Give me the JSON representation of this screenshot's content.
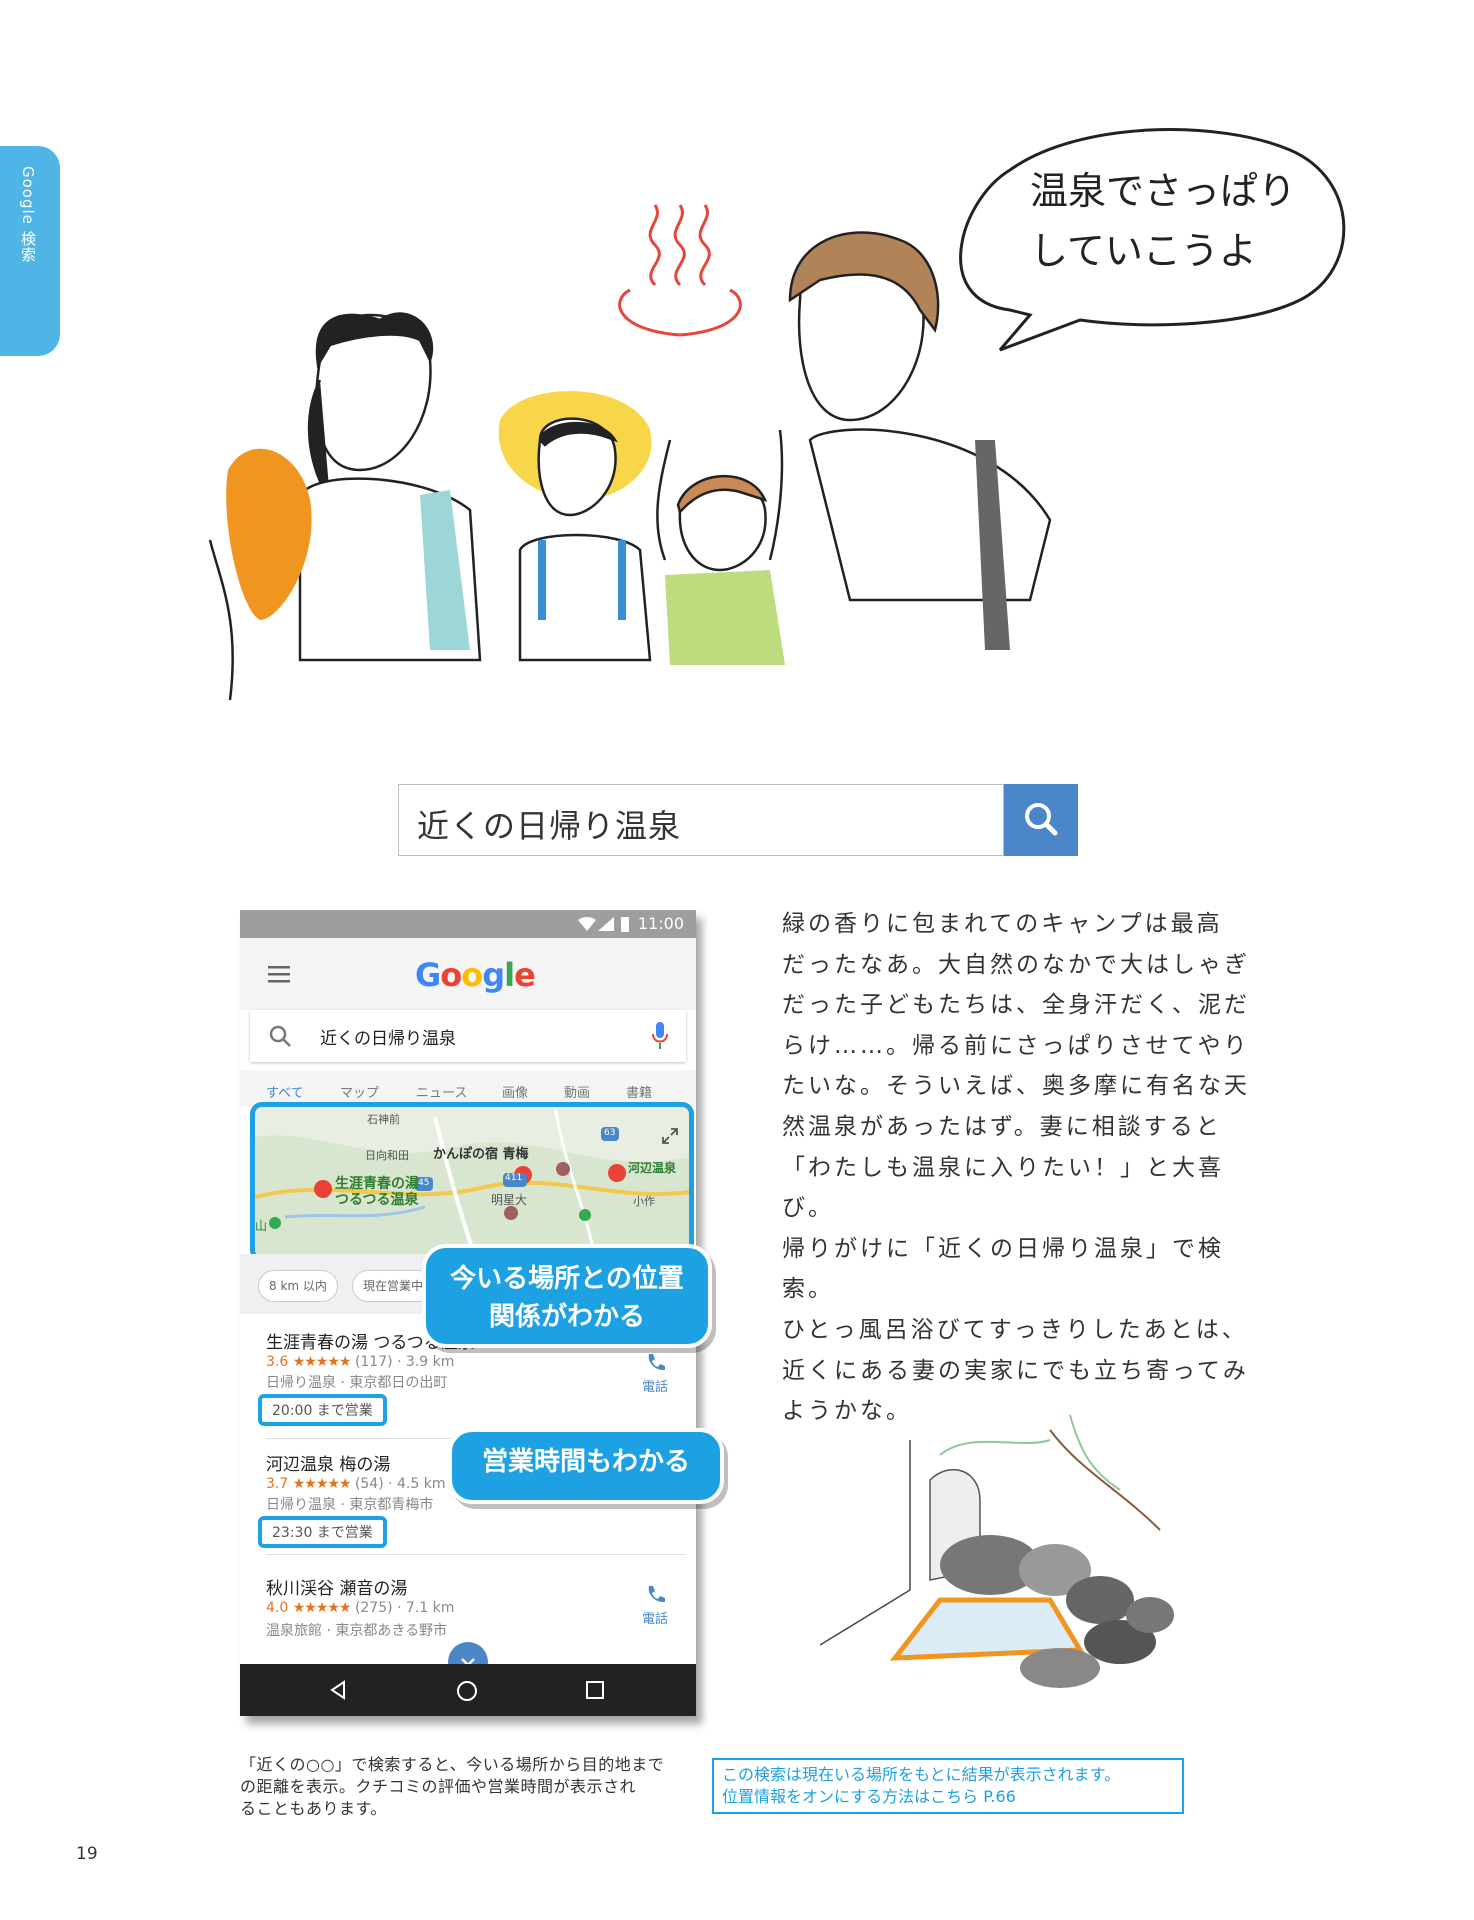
{
  "side_tab": {
    "label": "Google 検索"
  },
  "illustration": {
    "speech_line1": "温泉でさっぱり",
    "speech_line2": "していこうよ"
  },
  "search": {
    "query": "近くの日帰り温泉",
    "icon": "search-icon",
    "button_color": "#4a86c8"
  },
  "phone": {
    "status_time": "11:00",
    "logo": "Google",
    "search_query": "近くの日帰り温泉",
    "tabs": [
      "すべて",
      "マップ",
      "ニュース",
      "画像",
      "動画",
      "書籍"
    ],
    "map_labels": {
      "ishigamimae": "石神前",
      "hinatawada": "日向和田",
      "kanbonoyado": "かんぽの宿 青梅",
      "kawabe": "河辺温泉",
      "shogai_1": "生涯青春の湯",
      "shogai_2": "つるつる温泉",
      "meisei": "明星大",
      "ozaku": "小作",
      "yama": "山",
      "r411": "411",
      "r45": "45",
      "r63": "63"
    },
    "chips": [
      "8 km 以内",
      "現在営業中"
    ],
    "results": [
      {
        "name": "生涯青春の湯 つるつる温泉",
        "rating": "3.6",
        "stars": "★★★★★",
        "reviews": "(117) · 3.9 km",
        "info": "日帰り温泉 · 東京都日の出町",
        "hours": "20:00 まで営業",
        "call": "電話"
      },
      {
        "name": "河辺温泉 梅の湯",
        "rating": "3.7",
        "stars": "★★★★★",
        "reviews": "(54) · 4.5 km",
        "info": "日帰り温泉 · 東京都青梅市",
        "hours": "23:30 まで営業",
        "call": "電話"
      },
      {
        "name": "秋川渓谷 瀬音の湯",
        "rating": "4.0",
        "stars": "★★★★★",
        "reviews": "(275) · 7.1 km",
        "info": "温泉旅館 · 東京都あきる野市",
        "hours": "",
        "call": "電話"
      }
    ],
    "accent": "#1da1e2"
  },
  "callouts": {
    "location_line1": "今いる場所との位置",
    "location_line2": "関係がわかる",
    "hours": "営業時間もわかる"
  },
  "body_text": [
    "緑の香りに包まれてのキャンプは最高",
    "だったなあ。大自然のなかで大はしゃぎ",
    "だった子どもたちは、全身汗だく、泥だ",
    "らけ……。帰る前にさっぱりさせてやり",
    "たいな。そういえば、奥多摩に有名な天",
    "然温泉があったはず。妻に相談すると",
    "「わたしも温泉に入りたい！」と大喜び。",
    "帰りがけに「近くの日帰り温泉」で検索。",
    "ひとっ風呂浴びてすっきりしたあとは、",
    "近くにある妻の実家にでも立ち寄ってみ",
    "ようかな。"
  ],
  "caption": [
    "「近くの○○」で検索すると、今いる場所から目的地まで",
    "の距離を表示。クチコミの評価や営業時間が表示され",
    "ることもあります。"
  ],
  "note": [
    "この検索は現在いる場所をもとに結果が表示されます。",
    "位置情報をオンにする方法はこちら P.66"
  ],
  "page_number": "19"
}
